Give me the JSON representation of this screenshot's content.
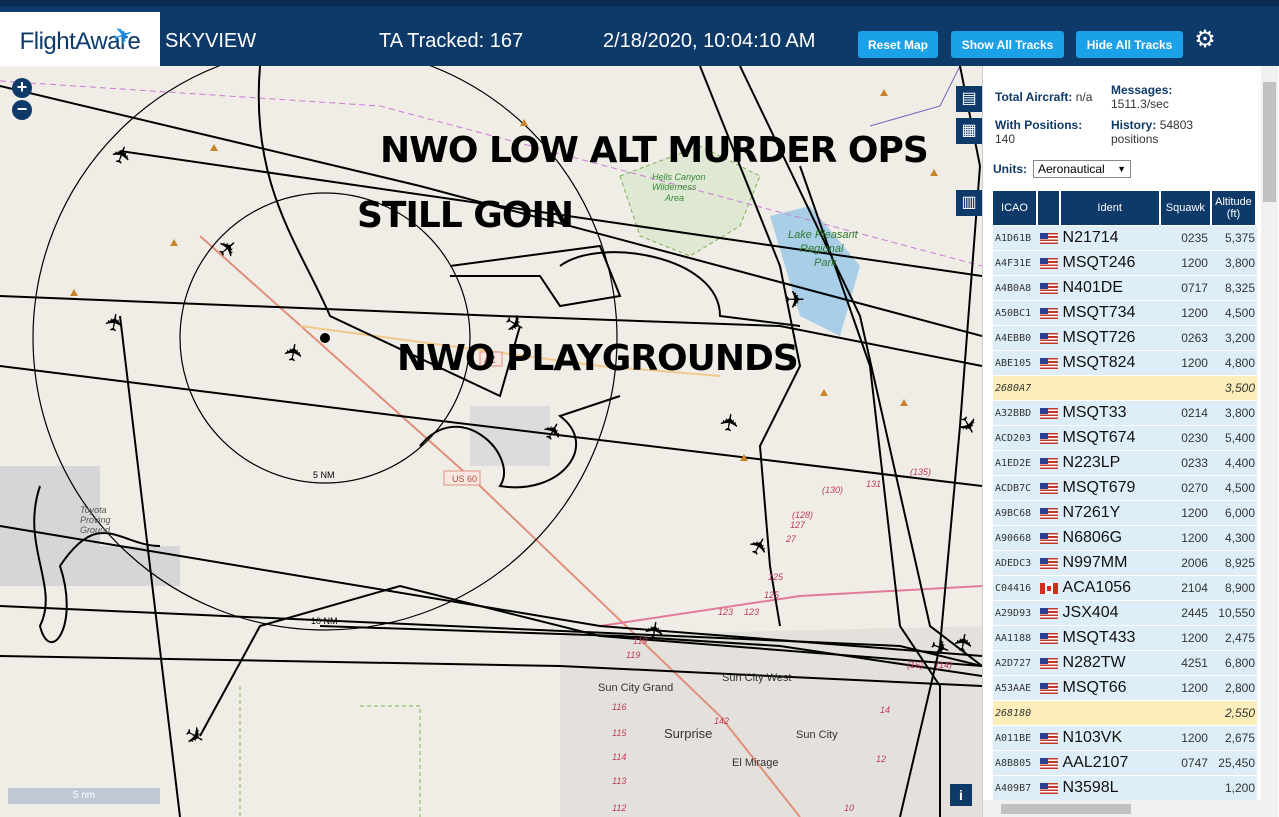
{
  "header": {
    "logo": "FlightAware",
    "app_title": "SKYVIEW",
    "tracked": "TA Tracked: 167",
    "datetime": "2/18/2020, 10:04:10 AM",
    "buttons": {
      "reset": "Reset Map",
      "show": "Show All Tracks",
      "hide": "Hide All Tracks"
    },
    "settings_icon": "gear-icon"
  },
  "map": {
    "overlay_texts": [
      "NWO LOW ALT MURDER OPS",
      "STILL GOIN",
      "NWO PLAYGROUNDS"
    ],
    "labels": {
      "wilderness": "Hells Canyon\nWilderness\nArea",
      "park": "Lake Pleasant\nRegional\nPark",
      "proving": "Toyota\nProving\nGround",
      "ring_5nm": "5 NM",
      "ring_10nm": "10 NM",
      "us60": "US 60",
      "az": "AZ",
      "sun_city_grand": "Sun City Grand",
      "sun_city_west": "Sun City West",
      "surprise": "Surprise",
      "sun_city": "Sun City",
      "el_mirage": "El Mirage",
      "route_numbers": [
        "(135)",
        "(130)",
        "131",
        "(128)",
        "127",
        "27",
        "125",
        "125",
        "123",
        "123",
        "119",
        "119",
        "116",
        "115",
        "114",
        "113",
        "112",
        "142",
        "14",
        "12",
        "10",
        "(16)",
        "(14)"
      ]
    },
    "scale": "5 nm",
    "icons": {
      "zoom_in": "+",
      "zoom_out": "−",
      "info": "i"
    }
  },
  "sidebar": {
    "total_aircraft_label": "Total Aircraft:",
    "total_aircraft_value": "n/a",
    "with_positions_label": "With Positions:",
    "with_positions_value": "140",
    "messages_label": "Messages:",
    "messages_value": "1511.3/sec",
    "history_label": "History:",
    "history_value": "54803",
    "history_unit": "positions",
    "units_label": "Units:",
    "units_value": "Aeronautical",
    "columns": [
      "ICAO",
      "",
      "Ident",
      "Squawk",
      "Altitude (ft)"
    ],
    "rows": [
      {
        "icao": "A1D61B",
        "flag": "us",
        "ident": "N21714",
        "squawk": "0235",
        "alt": "5,375"
      },
      {
        "icao": "A4F31E",
        "flag": "us",
        "ident": "MSQT246",
        "squawk": "1200",
        "alt": "3,800"
      },
      {
        "icao": "A4B0A8",
        "flag": "us",
        "ident": "N401DE",
        "squawk": "0717",
        "alt": "8,325"
      },
      {
        "icao": "A50BC1",
        "flag": "us",
        "ident": "MSQT734",
        "squawk": "1200",
        "alt": "4,500"
      },
      {
        "icao": "A4EBB0",
        "flag": "us",
        "ident": "MSQT726",
        "squawk": "0263",
        "alt": "3,200"
      },
      {
        "icao": "ABE105",
        "flag": "us",
        "ident": "MSQT824",
        "squawk": "1200",
        "alt": "4,800"
      },
      {
        "icao": "2680A7",
        "flag": "",
        "ident": "",
        "squawk": "",
        "alt": "3,500",
        "hl": true
      },
      {
        "icao": "A32BBD",
        "flag": "us",
        "ident": "MSQT33",
        "squawk": "0214",
        "alt": "3,800"
      },
      {
        "icao": "ACD203",
        "flag": "us",
        "ident": "MSQT674",
        "squawk": "0230",
        "alt": "5,400"
      },
      {
        "icao": "A1ED2E",
        "flag": "us",
        "ident": "N223LP",
        "squawk": "0233",
        "alt": "4,400"
      },
      {
        "icao": "ACDB7C",
        "flag": "us",
        "ident": "MSQT679",
        "squawk": "0270",
        "alt": "4,500"
      },
      {
        "icao": "A9BC68",
        "flag": "us",
        "ident": "N7261Y",
        "squawk": "1200",
        "alt": "6,000"
      },
      {
        "icao": "A90668",
        "flag": "us",
        "ident": "N6806G",
        "squawk": "1200",
        "alt": "4,300"
      },
      {
        "icao": "ADEDC3",
        "flag": "us",
        "ident": "N997MM",
        "squawk": "2006",
        "alt": "8,925"
      },
      {
        "icao": "C04416",
        "flag": "ca",
        "ident": "ACA1056",
        "squawk": "2104",
        "alt": "8,900"
      },
      {
        "icao": "A29D93",
        "flag": "us",
        "ident": "JSX404",
        "squawk": "2445",
        "alt": "10,550"
      },
      {
        "icao": "AA1188",
        "flag": "us",
        "ident": "MSQT433",
        "squawk": "1200",
        "alt": "2,475"
      },
      {
        "icao": "A2D727",
        "flag": "us",
        "ident": "N282TW",
        "squawk": "4251",
        "alt": "6,800"
      },
      {
        "icao": "A53AAE",
        "flag": "us",
        "ident": "MSQT66",
        "squawk": "1200",
        "alt": "2,800"
      },
      {
        "icao": "268180",
        "flag": "",
        "ident": "",
        "squawk": "",
        "alt": "2,550",
        "hl": true
      },
      {
        "icao": "A011BE",
        "flag": "us",
        "ident": "N103VK",
        "squawk": "1200",
        "alt": "2,675"
      },
      {
        "icao": "A8B805",
        "flag": "us",
        "ident": "AAL2107",
        "squawk": "0747",
        "alt": "25,450"
      },
      {
        "icao": "A409B7",
        "flag": "us",
        "ident": "N3598L",
        "squawk": "",
        "alt": "1,200"
      }
    ]
  }
}
